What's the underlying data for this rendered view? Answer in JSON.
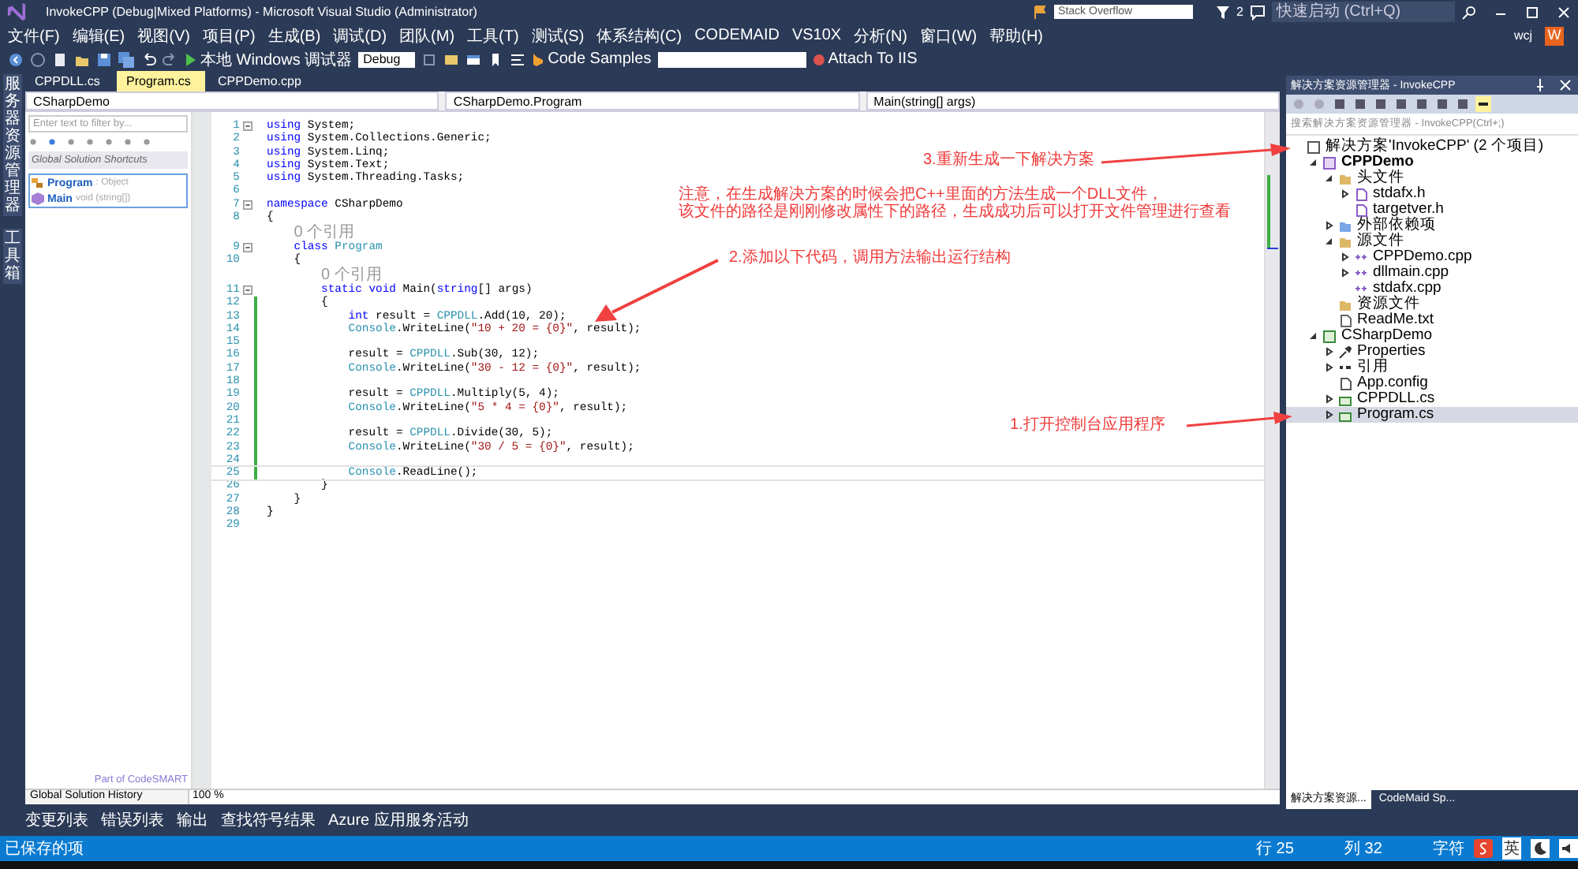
{
  "window": {
    "title": "InvokeCPP (Debug|Mixed Platforms) - Microsoft Visual Studio (Administrator)",
    "search_placeholder": "Stack Overflow",
    "notification_count": "2",
    "quick_launch_placeholder": "快速启动 (Ctrl+Q)"
  },
  "menu": {
    "items": [
      "文件(F)",
      "编辑(E)",
      "视图(V)",
      "项目(P)",
      "生成(B)",
      "调试(D)",
      "团队(M)",
      "工具(T)",
      "测试(S)",
      "体系结构(C)",
      "CODEMAID",
      "VS10X",
      "分析(N)",
      "窗口(W)",
      "帮助(H)"
    ],
    "user": "wcj",
    "avatar": "W"
  },
  "toolbar": {
    "debugger": "本地 Windows 调试器",
    "configuration": "Debug",
    "code_samples": "Code Samples",
    "attach": "Attach To IIS"
  },
  "side_strip": [
    "服务器资源管理器",
    "工具箱"
  ],
  "doc_tabs": [
    {
      "label": "CPPDLL.cs",
      "selected": false
    },
    {
      "label": "Program.cs",
      "selected": true
    },
    {
      "label": "CPPDemo.cpp",
      "selected": false
    }
  ],
  "nav_bar": [
    "CSharpDemo",
    "CSharpDemo.Program",
    "Main(string[] args)"
  ],
  "codesmart": {
    "filter_placeholder": "Enter text to filter by...",
    "header": "Global Solution Shortcuts",
    "items": [
      {
        "kind": "class",
        "name": "Program",
        "detail": ": Object"
      },
      {
        "kind": "method",
        "name": "Main",
        "detail": "void (string[])"
      }
    ],
    "footer": "Part of CodeSMART",
    "history": "Global Solution History"
  },
  "zoom": "100 %",
  "code": [
    {
      "kind": "code",
      "n": "1",
      "fold": true,
      "changed": false,
      "current": false,
      "seg": [
        {
          "kind": "keyword",
          "text": "using"
        },
        {
          "kind": "plain",
          "text": " System;"
        }
      ]
    },
    {
      "kind": "code",
      "n": "2",
      "fold": false,
      "changed": false,
      "current": false,
      "seg": [
        {
          "kind": "keyword",
          "text": "using"
        },
        {
          "kind": "plain",
          "text": " System.Collections.Generic;"
        }
      ]
    },
    {
      "kind": "code",
      "n": "3",
      "fold": false,
      "changed": false,
      "current": false,
      "seg": [
        {
          "kind": "keyword",
          "text": "using"
        },
        {
          "kind": "plain",
          "text": " System.Linq;"
        }
      ]
    },
    {
      "kind": "code",
      "n": "4",
      "fold": false,
      "changed": false,
      "current": false,
      "seg": [
        {
          "kind": "keyword",
          "text": "using"
        },
        {
          "kind": "plain",
          "text": " System.Text;"
        }
      ]
    },
    {
      "kind": "code",
      "n": "5",
      "fold": false,
      "changed": false,
      "current": false,
      "seg": [
        {
          "kind": "keyword",
          "text": "using"
        },
        {
          "kind": "plain",
          "text": " System.Threading.Tasks;"
        }
      ]
    },
    {
      "kind": "code",
      "n": "6",
      "fold": false,
      "changed": false,
      "current": false
    },
    {
      "kind": "code",
      "n": "7",
      "fold": true,
      "changed": false,
      "current": false,
      "seg": [
        {
          "kind": "keyword",
          "text": "namespace"
        },
        {
          "kind": "plain",
          "text": " CSharpDemo"
        }
      ]
    },
    {
      "kind": "code",
      "n": "8",
      "fold": false,
      "changed": false,
      "current": false,
      "seg": [
        {
          "kind": "plain",
          "text": "{"
        }
      ]
    },
    {
      "kind": "lens",
      "text": "0 个引用"
    },
    {
      "kind": "code",
      "n": "9",
      "fold": true,
      "changed": false,
      "current": false,
      "seg": [
        {
          "kind": "keyword",
          "text": "    class"
        },
        {
          "kind": "type",
          "text": " Program"
        }
      ]
    },
    {
      "kind": "code",
      "n": "10",
      "fold": false,
      "changed": false,
      "current": false,
      "seg": [
        {
          "kind": "plain",
          "text": "    {"
        }
      ]
    },
    {
      "kind": "lens",
      "text": "0 个引用"
    },
    {
      "kind": "code",
      "n": "11",
      "fold": true,
      "changed": false,
      "current": false,
      "seg": [
        {
          "kind": "keyword",
          "text": "        static"
        },
        {
          "kind": "keyword",
          "text": " void"
        },
        {
          "kind": "plain",
          "text": " Main("
        },
        {
          "kind": "keyword",
          "text": "string"
        },
        {
          "kind": "plain",
          "text": "[] args)"
        }
      ]
    },
    {
      "kind": "code",
      "n": "12",
      "fold": false,
      "changed": true,
      "current": false,
      "seg": [
        {
          "kind": "plain",
          "text": "        {"
        }
      ]
    },
    {
      "kind": "code",
      "n": "13",
      "fold": false,
      "changed": true,
      "current": false,
      "seg": [
        {
          "kind": "keyword",
          "text": "            int"
        },
        {
          "kind": "plain",
          "text": " result = "
        },
        {
          "kind": "type",
          "text": "CPPDLL"
        },
        {
          "kind": "plain",
          "text": ".Add(10, 20);"
        }
      ]
    },
    {
      "kind": "code",
      "n": "14",
      "fold": false,
      "changed": true,
      "current": false,
      "seg": [
        {
          "kind": "type",
          "text": "            Console"
        },
        {
          "kind": "plain",
          "text": ".WriteLine("
        },
        {
          "kind": "string",
          "text": "\"10 + 20 = {0}\""
        },
        {
          "kind": "plain",
          "text": ", result);"
        }
      ]
    },
    {
      "kind": "code",
      "n": "15",
      "fold": false,
      "changed": true,
      "current": false
    },
    {
      "kind": "code",
      "n": "16",
      "fold": false,
      "changed": true,
      "current": false,
      "seg": [
        {
          "kind": "plain",
          "text": "            result = "
        },
        {
          "kind": "type",
          "text": "CPPDLL"
        },
        {
          "kind": "plain",
          "text": ".Sub(30, 12);"
        }
      ]
    },
    {
      "kind": "code",
      "n": "17",
      "fold": false,
      "changed": true,
      "current": false,
      "seg": [
        {
          "kind": "type",
          "text": "            Console"
        },
        {
          "kind": "plain",
          "text": ".WriteLine("
        },
        {
          "kind": "string",
          "text": "\"30 - 12 = {0}\""
        },
        {
          "kind": "plain",
          "text": ", result);"
        }
      ]
    },
    {
      "kind": "code",
      "n": "18",
      "fold": false,
      "changed": true,
      "current": false
    },
    {
      "kind": "code",
      "n": "19",
      "fold": false,
      "changed": true,
      "current": false,
      "seg": [
        {
          "kind": "plain",
          "text": "            result = "
        },
        {
          "kind": "type",
          "text": "CPPDLL"
        },
        {
          "kind": "plain",
          "text": ".Multiply(5, 4);"
        }
      ]
    },
    {
      "kind": "code",
      "n": "20",
      "fold": false,
      "changed": true,
      "current": false,
      "seg": [
        {
          "kind": "type",
          "text": "            Console"
        },
        {
          "kind": "plain",
          "text": ".WriteLine("
        },
        {
          "kind": "string",
          "text": "\"5 * 4 = {0}\""
        },
        {
          "kind": "plain",
          "text": ", result);"
        }
      ]
    },
    {
      "kind": "code",
      "n": "21",
      "fold": false,
      "changed": true,
      "current": false
    },
    {
      "kind": "code",
      "n": "22",
      "fold": false,
      "changed": true,
      "current": false,
      "seg": [
        {
          "kind": "plain",
          "text": "            result = "
        },
        {
          "kind": "type",
          "text": "CPPDLL"
        },
        {
          "kind": "plain",
          "text": ".Divide(30, 5);"
        }
      ]
    },
    {
      "kind": "code",
      "n": "23",
      "fold": false,
      "changed": true,
      "current": false,
      "seg": [
        {
          "kind": "type",
          "text": "            Console"
        },
        {
          "kind": "plain",
          "text": ".WriteLine("
        },
        {
          "kind": "string",
          "text": "\"30 / 5 = {0}\""
        },
        {
          "kind": "plain",
          "text": ", result);"
        }
      ]
    },
    {
      "kind": "code",
      "n": "24",
      "fold": false,
      "changed": true,
      "current": false
    },
    {
      "kind": "code",
      "n": "25",
      "fold": false,
      "changed": true,
      "current": true,
      "seg": [
        {
          "kind": "type",
          "text": "            Console"
        },
        {
          "kind": "plain",
          "text": ".ReadLine();"
        }
      ]
    },
    {
      "kind": "code",
      "n": "26",
      "fold": false,
      "changed": false,
      "current": false,
      "seg": [
        {
          "kind": "plain",
          "text": "        }"
        }
      ]
    },
    {
      "kind": "code",
      "n": "27",
      "fold": false,
      "changed": false,
      "current": false,
      "seg": [
        {
          "kind": "plain",
          "text": "    }"
        }
      ]
    },
    {
      "kind": "code",
      "n": "28",
      "fold": false,
      "changed": false,
      "current": false,
      "seg": [
        {
          "kind": "plain",
          "text": "}"
        }
      ]
    },
    {
      "kind": "code",
      "n": "29",
      "fold": false,
      "changed": false,
      "current": false
    }
  ],
  "annotations": [
    {
      "kind": "label",
      "text": "3.重新生成一下解决方案"
    },
    {
      "kind": "note",
      "lines": [
        "注意，在生成解决方案的时候会把C++里面的方法生成一个DLL文件，",
        "该文件的路径是刚刚修改属性下的路径，生成成功后可以打开文件管理进行查看"
      ]
    },
    {
      "kind": "label",
      "text": "2.添加以下代码，调用方法输出运行结构"
    },
    {
      "kind": "label",
      "text": "1.打开控制台应用程序"
    }
  ],
  "solution_explorer": {
    "title": "解决方案资源管理器 - InvokeCPP",
    "search_placeholder": "搜索解决方案资源管理器 - InvokeCPP(Ctrl+;)",
    "tree": [
      {
        "kind": "solution",
        "label": "解决方案'InvokeCPP' (2 个项目)",
        "selected": false,
        "bold": false,
        "children": [
          {
            "kind": "cppproject",
            "label": "CPPDemo",
            "selected": false,
            "bold": true,
            "expanded": true,
            "children": [
              {
                "kind": "folder",
                "label": "头文件",
                "selected": false,
                "bold": false,
                "expanded": true,
                "children": [
                  {
                    "kind": "header",
                    "label": "stdafx.h",
                    "selected": false,
                    "bold": false,
                    "expanded": false
                  },
                  {
                    "kind": "header",
                    "label": "targetver.h",
                    "selected": false,
                    "bold": false
                  }
                ]
              },
              {
                "kind": "deps",
                "label": "外部依赖项",
                "selected": false,
                "bold": false,
                "expanded": false
              },
              {
                "kind": "folder",
                "label": "源文件",
                "selected": false,
                "bold": false,
                "expanded": true,
                "children": [
                  {
                    "kind": "cpp",
                    "label": "CPPDemo.cpp",
                    "selected": false,
                    "bold": false,
                    "expanded": false
                  },
                  {
                    "kind": "cpp",
                    "label": "dllmain.cpp",
                    "selected": false,
                    "bold": false,
                    "expanded": false
                  },
                  {
                    "kind": "cpp",
                    "label": "stdafx.cpp",
                    "selected": false,
                    "bold": false
                  }
                ]
              },
              {
                "kind": "folder",
                "label": "资源文件",
                "selected": false,
                "bold": false
              },
              {
                "kind": "txt",
                "label": "ReadMe.txt",
                "selected": false,
                "bold": false
              }
            ]
          },
          {
            "kind": "csproject",
            "label": "CSharpDemo",
            "selected": false,
            "bold": false,
            "expanded": true,
            "children": [
              {
                "kind": "properties",
                "label": "Properties",
                "selected": false,
                "bold": false,
                "expanded": false
              },
              {
                "kind": "refs",
                "label": "引用",
                "selected": false,
                "bold": false,
                "expanded": false
              },
              {
                "kind": "config",
                "label": "App.config",
                "selected": false,
                "bold": false
              },
              {
                "kind": "cs",
                "label": "CPPDLL.cs",
                "selected": false,
                "bold": false,
                "expanded": false
              },
              {
                "kind": "cs",
                "label": "Program.cs",
                "selected": true,
                "bold": false,
                "expanded": false
              }
            ]
          }
        ]
      }
    ],
    "tabs": [
      {
        "label": "解决方案资源...",
        "selected": true
      },
      {
        "label": "CodeMaid Sp...",
        "selected": false
      }
    ]
  },
  "bottom_tabs": [
    "变更列表",
    "错误列表",
    "输出",
    "查找符号结果",
    "Azure 应用服务活动"
  ],
  "status_bar": {
    "message": "已保存的项",
    "line": "行 25",
    "column": "列 32",
    "char": "字符",
    "ime": "英"
  }
}
